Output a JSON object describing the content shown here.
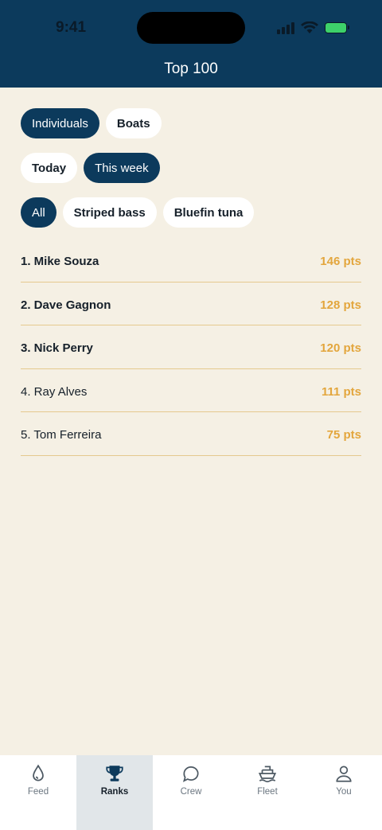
{
  "status_bar": {
    "time": "9:41"
  },
  "header": {
    "title": "Top 100"
  },
  "filters": {
    "scope": [
      {
        "label": "Individuals",
        "active": true
      },
      {
        "label": "Boats",
        "active": false
      }
    ],
    "period": [
      {
        "label": "Today",
        "active": false
      },
      {
        "label": "This week",
        "active": true
      }
    ],
    "species": [
      {
        "label": "All",
        "active": true
      },
      {
        "label": "Striped bass",
        "active": false
      },
      {
        "label": "Bluefin tuna",
        "active": false
      }
    ]
  },
  "rankings": [
    {
      "name": "1. Mike Souza",
      "points": "146 pts"
    },
    {
      "name": "2. Dave Gagnon",
      "points": "128 pts"
    },
    {
      "name": "3. Nick Perry",
      "points": "120 pts"
    },
    {
      "name": "4. Ray Alves",
      "points": "111 pts"
    },
    {
      "name": "5. Tom Ferreira",
      "points": "75 pts"
    }
  ],
  "tabbar": {
    "items": [
      {
        "label": "Feed",
        "icon": "drop-icon"
      },
      {
        "label": "Ranks",
        "icon": "trophy-icon"
      },
      {
        "label": "Crew",
        "icon": "chat-icon"
      },
      {
        "label": "Fleet",
        "icon": "boat-icon"
      },
      {
        "label": "You",
        "icon": "person-icon"
      }
    ],
    "active": "Ranks"
  },
  "colors": {
    "header": "#0c3a5c",
    "background": "#f5f0e4",
    "points": "#e3a63d",
    "divider": "#e5c98e"
  }
}
